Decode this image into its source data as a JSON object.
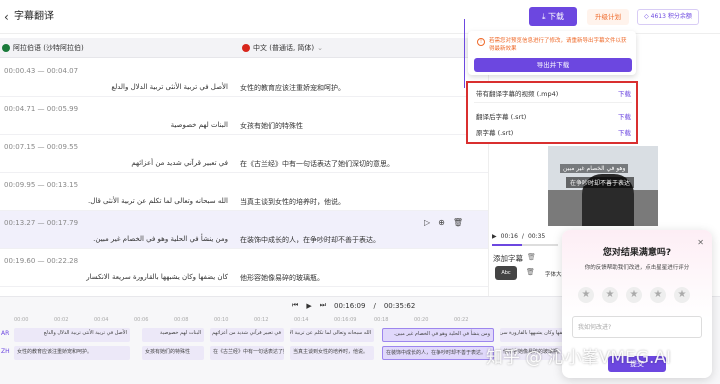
{
  "header": {
    "back_icon": "chevron-left",
    "title": "字幕翻译",
    "download_label": "下载",
    "upgrade_label": "升级计划",
    "credits_label": "4613 积分余额"
  },
  "languages": {
    "source": "阿拉伯语 (沙特阿拉伯)",
    "target": "中文 (普通话, 简体)"
  },
  "rows": [
    {
      "start": "00:00.43",
      "end": "00:04.07",
      "ar": "الأصل في تربية الأنثى تربية الدلال والدلع",
      "zh": "女性的教育应该注重娇宠和呵护。",
      "selected": false
    },
    {
      "start": "00:04.71",
      "end": "00:05.99",
      "ar": "البنات لهم خصوصية",
      "zh": "女孩有她们的特殊性",
      "selected": false
    },
    {
      "start": "00:07.15",
      "end": "00:09.55",
      "ar": "في تعبير قرآني شديد من أعزائهم",
      "zh": "在《古兰经》中有一句话表达了她们深切的意思。",
      "selected": false
    },
    {
      "start": "00:09.95",
      "end": "00:13.15",
      "ar": "الله سبحانه وتعالى لما تكلم عن تربية الأنثى قال.",
      "zh": "当真主谈到女性的培养时，他说。",
      "selected": false
    },
    {
      "start": "00:13.27",
      "end": "00:17.79",
      "ar": "ومن ينشأ في الحلية وهو في الخصام غير مبين.",
      "zh": "在装饰中成长的人，在争吵时却不善于表达。",
      "selected": true
    },
    {
      "start": "00:19.60",
      "end": "00:22.28",
      "ar": "كان يضفها وكان يشبهها بالقارورة سريعة الانكسار",
      "zh": "他形容她像易碎的玻璃瓶。",
      "selected": false
    }
  ],
  "row_icons": [
    "play-icon",
    "translate-icon",
    "trash-icon"
  ],
  "alert": {
    "text": "若需您对预览信息进行了修改，请重新导出字幕文件以获得最新效果",
    "export_label": "导出并下载"
  },
  "download_menu": [
    {
      "label": "带有翻译字幕的视频 (.mp4)",
      "action": "下载"
    },
    {
      "label": "翻译后字幕 (.srt)",
      "action": "下载"
    },
    {
      "label": "原字幕 (.srt)",
      "action": "下载"
    }
  ],
  "video": {
    "sub_ar": "وهو في الخصام غير مبين",
    "sub_zh": "在争吵时却不善于表达",
    "current": "00:16",
    "total": "00:35",
    "progress": 0.46
  },
  "subtitle_panel": {
    "add_label": "添加字幕",
    "style_label": "Abc",
    "font_label": "字体大小"
  },
  "timeline": {
    "current": "00:16:09",
    "total": "00:35:62",
    "track_labels": [
      "AR",
      "ZH"
    ],
    "ticks": [
      "00:00",
      "00:02",
      "00:04",
      "00:06",
      "00:08",
      "00:10",
      "00:12",
      "00:14",
      "00:16:09",
      "00:18",
      "00:20",
      "00:22"
    ]
  },
  "survey": {
    "title": "您对结果满意吗?",
    "subtitle": "你的反馈帮助我们改进，点击星星进行评分",
    "placeholder": "我如何改进?",
    "submit": "提交",
    "rating": 0,
    "max": 5
  },
  "watermark": "知乎 @ 沁小峯VMEG.AI",
  "colors": {
    "accent": "#6c47e0",
    "warning": "#ef6a2a",
    "highlight": "#d92f2f"
  }
}
